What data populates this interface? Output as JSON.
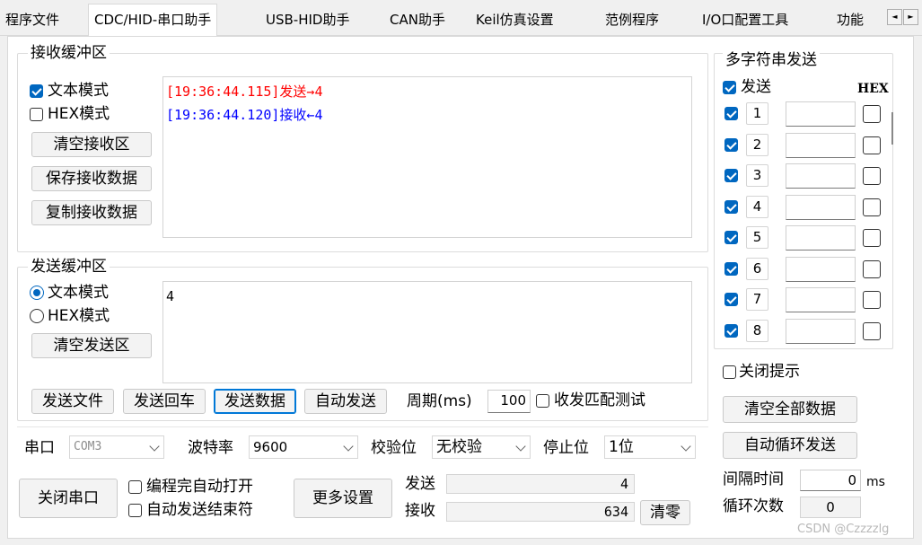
{
  "tabs": [
    "程序文件",
    "CDC/HID-串口助手",
    "USB-HID助手",
    "CAN助手",
    "Keil仿真设置",
    "范例程序",
    "I/O口配置工具",
    "功能"
  ],
  "tab_scroll": {
    "left": "◄",
    "right": "►"
  },
  "receive": {
    "title": "接收缓冲区",
    "text_mode": "文本模式",
    "hex_mode": "HEX模式",
    "clear_btn": "清空接收区",
    "save_btn": "保存接收数据",
    "copy_btn": "复制接收数据",
    "lines": [
      "[19:36:44.115]发送→4",
      "[19:36:44.120]接收←4"
    ]
  },
  "send": {
    "title": "发送缓冲区",
    "text_mode": "文本模式",
    "hex_mode": "HEX模式",
    "clear_btn": "清空发送区",
    "content": "4",
    "send_file": "发送文件",
    "send_enter": "发送回车",
    "send_data": "发送数据",
    "auto_send": "自动发送",
    "period_label": "周期(ms)",
    "period_value": "100",
    "match_test": "收发匹配测试"
  },
  "serial": {
    "port_label": "串口",
    "port_value": "COM3",
    "baud_label": "波特率",
    "baud_value": "9600",
    "parity_label": "校验位",
    "parity_value": "无校验",
    "stop_label": "停止位",
    "stop_value": "1位",
    "close_btn": "关闭串口",
    "auto_open": "编程完自动打开",
    "auto_end": "自动发送结束符",
    "more_btn": "更多设置",
    "sent_label": "发送",
    "sent_count": "4",
    "recv_label": "接收",
    "recv_count": "634",
    "clear_btn": "清零"
  },
  "multi": {
    "title": "多字符串发送",
    "send_header": "发送",
    "hex_header": "HEX",
    "rows": [
      "1",
      "2",
      "3",
      "4",
      "5",
      "6",
      "7",
      "8"
    ],
    "close_hint": "关闭提示",
    "clear_all_btn": "清空全部数据",
    "auto_loop_btn": "自动循环发送",
    "interval_label": "间隔时间",
    "interval_value": "0",
    "interval_unit": "ms",
    "loop_label": "循环次数",
    "loop_value": "0"
  },
  "watermark": "CSDN @Czzzzlg",
  "colors": {
    "sent": "#ff0000",
    "received": "#0000ff",
    "accent": "#0067c0"
  }
}
